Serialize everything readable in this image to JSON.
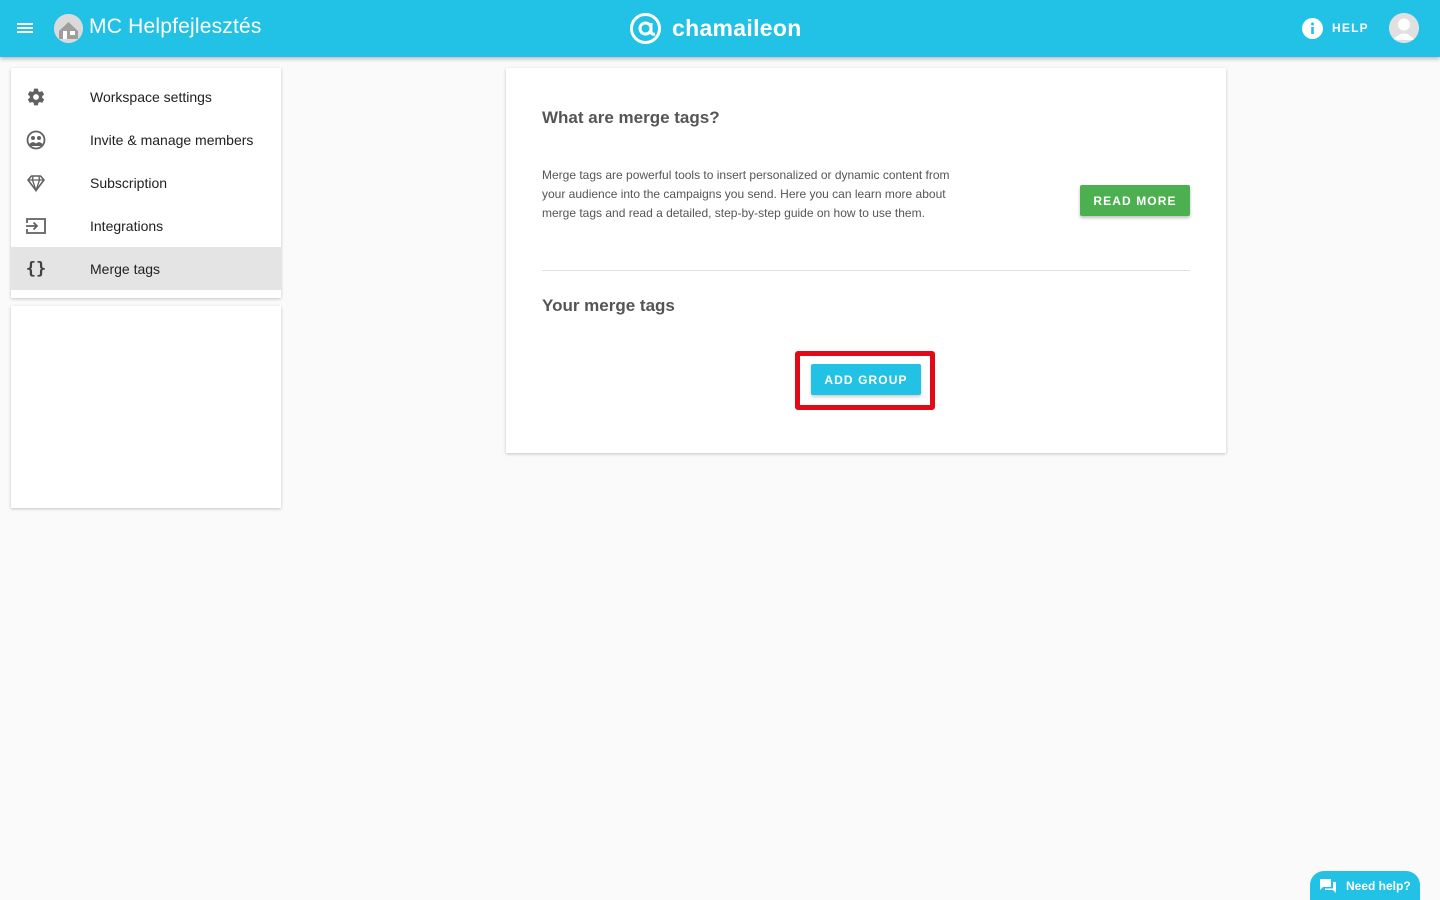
{
  "topbar": {
    "workspace_name": "MC Helpfejlesztés",
    "brand_name": "chamaileon",
    "help_label": "HELP",
    "color": "#22c1e6"
  },
  "sidebar": {
    "items": [
      {
        "label": "Workspace settings",
        "icon": "gear-icon",
        "active": false
      },
      {
        "label": "Invite & manage members",
        "icon": "members-icon",
        "active": false
      },
      {
        "label": "Subscription",
        "icon": "diamond-icon",
        "active": false
      },
      {
        "label": "Integrations",
        "icon": "integrations-icon",
        "active": false
      },
      {
        "label": "Merge tags",
        "icon": "braces-icon",
        "glyph": "{}",
        "active": true
      }
    ]
  },
  "main": {
    "what_title": "What are merge tags?",
    "what_description": "Merge tags are powerful tools to insert personalized or dynamic content from your audience into the campaigns you send. Here you can learn more about merge tags and read a detailed, step-by-step guide on how to use them.",
    "read_more_label": "READ MORE",
    "read_more_color": "#4caf50",
    "your_title": "Your merge tags",
    "add_group_label": "ADD GROUP",
    "highlight_color": "#e20a17"
  },
  "chat": {
    "label": "Need help?",
    "icon": "chat-bubble-icon"
  }
}
